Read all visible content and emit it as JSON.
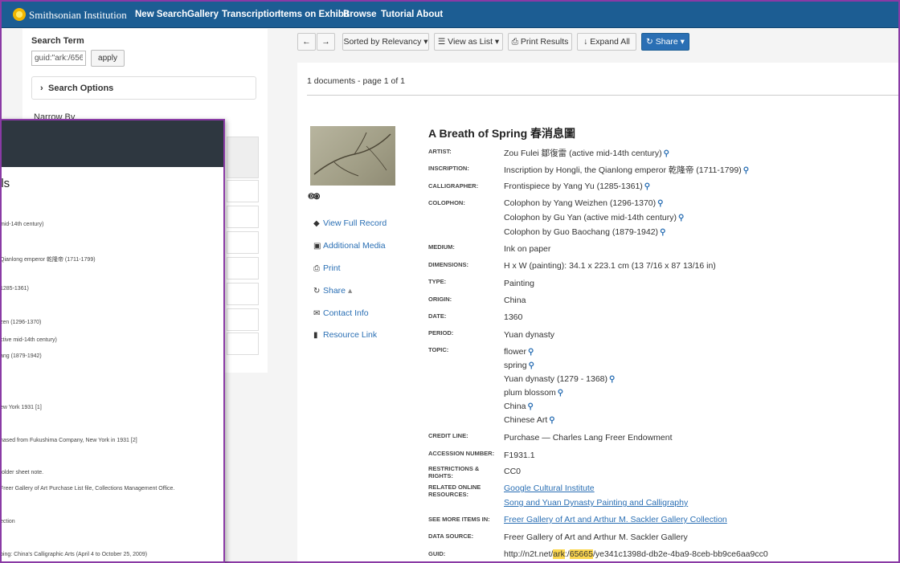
{
  "nav": {
    "brand": "Smithsonian Institution",
    "items": [
      "New Search",
      "Gallery",
      "Transcription",
      "Items on Exhibit",
      "Browse",
      "Tutorial",
      "About"
    ]
  },
  "sidebar": {
    "search_term_label": "Search Term",
    "search_value": "guid:\"ark:/65665/\\",
    "apply_label": "apply",
    "search_options_label": "Search Options",
    "narrow_by_label": "Narrow By"
  },
  "toolbar": {
    "back_icon": "←",
    "forward_icon": "→",
    "sort_label": "Sorted by Relevancy ▾",
    "view_label": "View as List ▾",
    "print_label": "Print Results",
    "expand_label": "Expand All",
    "share_label": "Share ▾"
  },
  "results": {
    "count_text": "1 documents - page 1 of 1"
  },
  "record": {
    "title": "A Breath of Spring 春消息圖",
    "cc_text": "🅭🄍",
    "actions": [
      "View Full Record",
      "Additional Media",
      "Print",
      "Share",
      "Contact Info",
      "Resource Link"
    ],
    "fields": {
      "artist_k": "ARTIST:",
      "artist_v": "Zou Fulei 鄒復雷 (active mid-14th century)",
      "inscription_k": "INSCRIPTION:",
      "inscription_v": "Inscription by Hongli, the Qianlong emperor 乾隆帝 (1711-1799)",
      "calligrapher_k": "CALLIGRAPHER:",
      "calligrapher_v": "Frontispiece by Yang Yu (1285-1361)",
      "colophon_k": "COLOPHON:",
      "colophon_v1": "Colophon by Yang Weizhen (1296-1370)",
      "colophon_v2": "Colophon by Gu Yan (active mid-14th century)",
      "colophon_v3": "Colophon by Guo Baochang (1879-1942)",
      "medium_k": "MEDIUM:",
      "medium_v": "Ink on paper",
      "dimensions_k": "DIMENSIONS:",
      "dimensions_v": "H x W (painting): 34.1 x 223.1 cm (13 7/16 x 87 13/16 in)",
      "type_k": "TYPE:",
      "type_v": "Painting",
      "origin_k": "ORIGIN:",
      "origin_v": "China",
      "date_k": "DATE:",
      "date_v": "1360",
      "period_k": "PERIOD:",
      "period_v": "Yuan dynasty",
      "topic_k": "TOPIC:",
      "topics": [
        "flower",
        "spring",
        "Yuan dynasty (1279 - 1368)",
        "plum blossom",
        "China",
        "Chinese Art"
      ],
      "credit_k": "CREDIT LINE:",
      "credit_v": "Purchase — Charles Lang Freer Endowment",
      "accession_k": "ACCESSION NUMBER:",
      "accession_v": "F1931.1",
      "restrictions_k": "RESTRICTIONS & RIGHTS:",
      "restrictions_v": "CC0",
      "related_k": "RELATED ONLINE RESOURCES:",
      "related_v1": "Google Cultural Institute",
      "related_v2": "Song and Yuan Dynasty Painting and Calligraphy",
      "seemore_k": "SEE MORE ITEMS IN:",
      "seemore_v": "Freer Gallery of Art and Arthur M. Sackler Gallery Collection",
      "datasource_k": "DATA SOURCE:",
      "datasource_v": "Freer Gallery of Art and Arthur M. Sackler Gallery",
      "guid_k": "GUID:",
      "guid_pre": "http://n2t.net/",
      "guid_ark": "ark",
      "guid_mid": ":/",
      "guid_num": "65665",
      "guid_post": "/ye341c1398d-db2e-4ba9-8ceb-bb9ce6aa9cc0"
    }
  },
  "overlay": {
    "title": "ils",
    "lines": [
      "mid-14th century)",
      " Qianlong emperor 乾隆帝 (1711-1799)",
      "1285-1361)",
      "zen (1296-1370)",
      "ctive mid-14th century)",
      "ang (1879-1942)",
      "ew York 1931 [1]",
      "hased from Fukushima Company, New York in 1931 [2]",
      "folder sheet note.",
      "Freer Gallery of Art Purchase List file, Collections Management Office.",
      "ection",
      "bing: China's Calligraphic Arts (April 4 to October 25, 2009)"
    ]
  },
  "colors": {
    "nav": "#1c5d93",
    "accent": "#2a6fb4",
    "frame": "#8a3aa5",
    "overlay_header": "#2e3740"
  }
}
